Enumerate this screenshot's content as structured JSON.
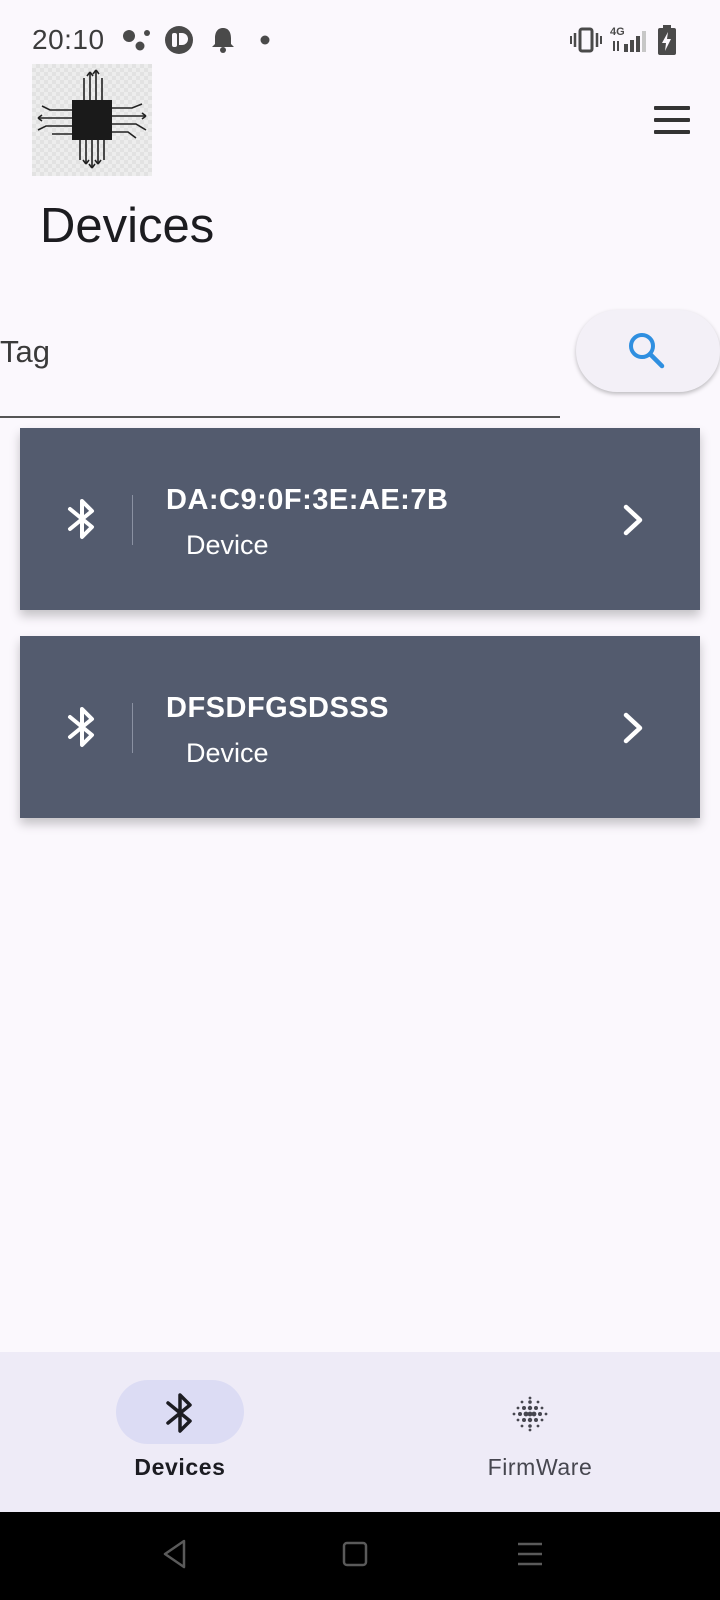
{
  "status_bar": {
    "time": "20:10",
    "network_label": "4G",
    "icons": [
      "assistant-dots-icon",
      "app-notification-icon",
      "bell-icon",
      "dot-icon",
      "vibrate-icon",
      "network-4g-icon",
      "signal-icon",
      "battery-charging-icon"
    ]
  },
  "header": {
    "logo_icon": "circuit-chip-logo",
    "menu_icon": "hamburger-menu-icon",
    "title": "Devices"
  },
  "search": {
    "placeholder": "Tag",
    "value": "",
    "button_icon": "search-icon",
    "accent_color": "#2f8fe0"
  },
  "devices": [
    {
      "name": "DA:C9:0F:3E:AE:7B",
      "type": "Device",
      "icon": "bluetooth-icon",
      "action_icon": "chevron-right-icon"
    },
    {
      "name": "DFSDFGSDSSS",
      "type": "Device",
      "icon": "bluetooth-icon",
      "action_icon": "chevron-right-icon"
    }
  ],
  "bottom_nav": {
    "items": [
      {
        "label": "Devices",
        "icon": "bluetooth-icon",
        "selected": true
      },
      {
        "label": "FirmWare",
        "icon": "dotted-grid-icon",
        "selected": false
      }
    ]
  },
  "system_nav": {
    "buttons": [
      "back-icon",
      "home-icon",
      "recents-icon"
    ]
  },
  "colors": {
    "background": "#fbf8fd",
    "card": "#535b6e",
    "bottom_nav": "#eeebf7",
    "nav_indicator": "#dcdcf4"
  }
}
